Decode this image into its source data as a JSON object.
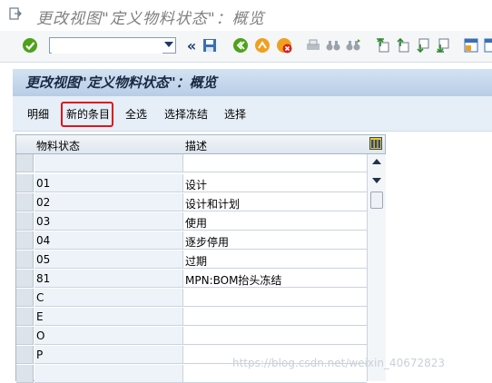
{
  "window": {
    "title": "更改视图\"定义物料状态\"：概览"
  },
  "screen": {
    "title": "更改视图\"定义物料状态\"：概览"
  },
  "toolbar": {
    "command_field": {
      "value": "",
      "placeholder": ""
    },
    "icons": [
      "enter-icon",
      "back-icon",
      "save-icon",
      "back-green-icon",
      "exit-icon",
      "cancel-icon",
      "print-icon",
      "find-icon",
      "find-next-icon",
      "first-page-icon",
      "prev-page-icon",
      "next-page-icon",
      "last-page-icon",
      "new-session-icon",
      "shortcut-icon"
    ]
  },
  "app_toolbar": {
    "details": "明细",
    "new_entries": "新的条目",
    "select_all": "全选",
    "select_block": "选择冻结",
    "select": "选择"
  },
  "table": {
    "columns": [
      "物料状态",
      "描述"
    ],
    "rows": [
      {
        "status": "",
        "desc": ""
      },
      {
        "status": "01",
        "desc": "设计"
      },
      {
        "status": "02",
        "desc": "设计和计划"
      },
      {
        "status": "03",
        "desc": "使用"
      },
      {
        "status": "04",
        "desc": "逐步停用"
      },
      {
        "status": "05",
        "desc": "过期"
      },
      {
        "status": "81",
        "desc": "MPN:BOM抬头冻结"
      },
      {
        "status": "C",
        "desc": ""
      },
      {
        "status": "E",
        "desc": ""
      },
      {
        "status": "O",
        "desc": ""
      },
      {
        "status": "P",
        "desc": ""
      },
      {
        "status": "",
        "desc": ""
      },
      {
        "status": "",
        "desc": ""
      }
    ]
  },
  "watermark": "https://blog.csdn.net/weixin_40672823"
}
